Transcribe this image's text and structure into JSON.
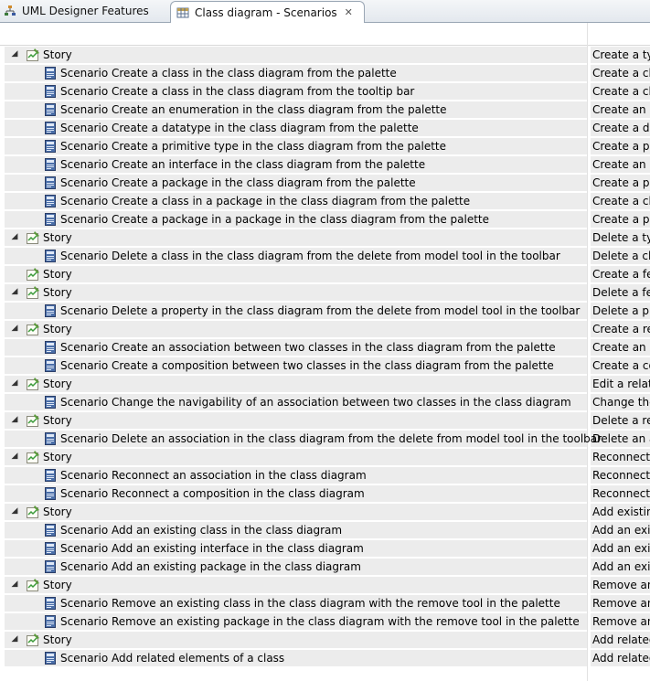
{
  "tabs": [
    {
      "label": "UML Designer Features",
      "icon": "sitemap-icon",
      "active": false
    },
    {
      "label": "Class diagram - Scenarios",
      "icon": "table-icon",
      "active": true,
      "close": "✕"
    }
  ],
  "rows": [
    {
      "type": "story",
      "expanded": true,
      "label": "Story",
      "col2": "Create a ty"
    },
    {
      "type": "scenario",
      "label": "Scenario Create a class in the class diagram from the palette",
      "col2": "Create a cl"
    },
    {
      "type": "scenario",
      "label": "Scenario Create a class in the class diagram from the tooltip bar",
      "col2": "Create a cl"
    },
    {
      "type": "scenario",
      "label": "Scenario Create an enumeration in the class diagram from the palette",
      "col2": "Create an e"
    },
    {
      "type": "scenario",
      "label": "Scenario Create a datatype in the class diagram from the palette",
      "col2": "Create a da"
    },
    {
      "type": "scenario",
      "label": "Scenario Create a primitive type in the class diagram from the palette",
      "col2": "Create a pr"
    },
    {
      "type": "scenario",
      "label": "Scenario Create an interface in the class diagram from the palette",
      "col2": "Create an i"
    },
    {
      "type": "scenario",
      "label": "Scenario Create a package in the class diagram from the palette",
      "col2": "Create a pa"
    },
    {
      "type": "scenario",
      "label": "Scenario Create a class in a package in the class diagram from the palette",
      "col2": "Create a cl"
    },
    {
      "type": "scenario",
      "label": "Scenario Create a package in a package in the class diagram from the palette",
      "col2": "Create a pa"
    },
    {
      "type": "story",
      "expanded": true,
      "label": "Story",
      "col2": "Delete a ty"
    },
    {
      "type": "scenario",
      "label": "Scenario Delete a class in the class diagram from the delete from model tool in the toolbar",
      "col2": "Delete a cl"
    },
    {
      "type": "story",
      "expanded": false,
      "label": "Story",
      "col2": "Create a fe"
    },
    {
      "type": "story",
      "expanded": true,
      "label": "Story",
      "col2": "Delete a fe"
    },
    {
      "type": "scenario",
      "label": "Scenario Delete a property in the class diagram from the delete from model tool in the toolbar",
      "col2": "Delete a pr"
    },
    {
      "type": "story",
      "expanded": true,
      "label": "Story",
      "col2": "Create a re"
    },
    {
      "type": "scenario",
      "label": "Scenario Create an association between two classes in the class diagram from the palette",
      "col2": "Create an a"
    },
    {
      "type": "scenario",
      "label": "Scenario Create a composition between two classes in the class diagram from the palette",
      "col2": "Create a co"
    },
    {
      "type": "story",
      "expanded": true,
      "label": "Story",
      "col2": "Edit a relat"
    },
    {
      "type": "scenario",
      "label": "Scenario Change the navigability of an association between two classes in the class diagram",
      "col2": "Change the"
    },
    {
      "type": "story",
      "expanded": true,
      "label": "Story",
      "col2": "Delete a re"
    },
    {
      "type": "scenario",
      "label": "Scenario Delete an association in the class diagram from the delete from model tool in the toolbar",
      "col2": "Delete an a"
    },
    {
      "type": "story",
      "expanded": true,
      "label": "Story",
      "col2": "Reconnect"
    },
    {
      "type": "scenario",
      "label": "Scenario Reconnect an association in the class diagram",
      "col2": "Reconnect"
    },
    {
      "type": "scenario",
      "label": "Scenario Reconnect a composition in the class diagram",
      "col2": "Reconnect"
    },
    {
      "type": "story",
      "expanded": true,
      "label": "Story",
      "col2": "Add existin"
    },
    {
      "type": "scenario",
      "label": "Scenario Add an existing class in the class diagram",
      "col2": "Add an exi"
    },
    {
      "type": "scenario",
      "label": "Scenario Add an existing interface in the class diagram",
      "col2": "Add an exi"
    },
    {
      "type": "scenario",
      "label": "Scenario Add an existing package in the class diagram",
      "col2": "Add an exi"
    },
    {
      "type": "story",
      "expanded": true,
      "label": "Story",
      "col2": "Remove an"
    },
    {
      "type": "scenario",
      "label": "Scenario Remove an existing class in the class diagram with the remove tool in the palette",
      "col2": "Remove an"
    },
    {
      "type": "scenario",
      "label": "Scenario Remove an existing package in the class diagram with the remove tool in the palette",
      "col2": "Remove an"
    },
    {
      "type": "story",
      "expanded": true,
      "label": "Story",
      "col2": "Add related"
    },
    {
      "type": "scenario",
      "label": "Scenario Add related elements of a class",
      "col2": "Add related"
    }
  ]
}
